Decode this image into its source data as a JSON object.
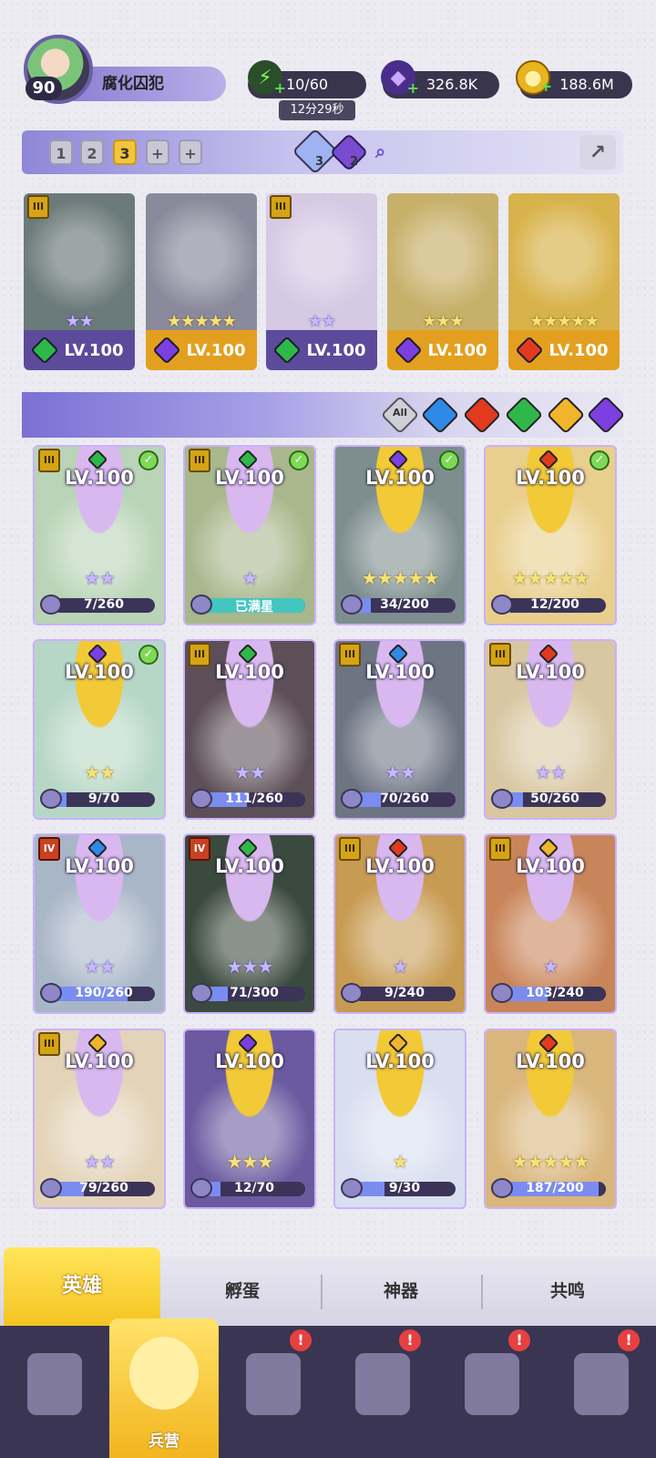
{
  "player": {
    "level": "90",
    "name": "腐化囚犯"
  },
  "resources": {
    "energy": "10/60",
    "energy_timer": "12分29秒",
    "gems": "326.8K",
    "gold": "188.6M"
  },
  "team_tabs": [
    "1",
    "2",
    "3",
    "+",
    "+"
  ],
  "team_tab_active": "3",
  "crystals": [
    {
      "name": "blue-crystal",
      "count": "3",
      "color": "#9fb3f2"
    },
    {
      "name": "purple-crystal",
      "count": "2",
      "color": "#7a4bd0"
    }
  ],
  "element_colors": {
    "green": "#2fb84a",
    "dark": "#7c3fe0",
    "fire": "#e23a1e",
    "water": "#2f89e6",
    "light": "#f0b52c"
  },
  "team": [
    {
      "level": "LV.100",
      "element": "green",
      "rank": "III",
      "stars": "★★",
      "star_style": "purple",
      "bg": "#6b7a7a",
      "foot": "#5c4b9a"
    },
    {
      "level": "LV.100",
      "element": "dark",
      "rank": "",
      "stars": "★★★★★",
      "star_style": "gold",
      "bg": "#8a8a9c",
      "foot": "#e3a020"
    },
    {
      "level": "LV.100",
      "element": "green",
      "rank": "III",
      "stars": "★★",
      "star_style": "purple",
      "bg": "#d6c9e4",
      "foot": "#5c4b9a"
    },
    {
      "level": "LV.100",
      "element": "dark",
      "rank": "",
      "stars": "★★★",
      "star_style": "gold",
      "bg": "#c7b06a",
      "foot": "#e3a020"
    },
    {
      "level": "LV.100",
      "element": "fire",
      "rank": "",
      "stars": "★★★★★",
      "star_style": "gold",
      "bg": "#d8b24a",
      "foot": "#e3a020"
    }
  ],
  "filter": {
    "all_label": "All",
    "elements": [
      "water",
      "fire",
      "green",
      "light",
      "dark"
    ]
  },
  "heroes": [
    {
      "level": "LV.100",
      "element": "green",
      "rank": "III",
      "check": true,
      "stars": "★★",
      "star_style": "purple",
      "progress": "7/260",
      "fill": 0.03,
      "bg": "#b9d4b6"
    },
    {
      "level": "LV.100",
      "element": "green",
      "rank": "III",
      "check": true,
      "stars": "★",
      "star_style": "purple",
      "progress": "已满星",
      "fill": 1,
      "bg": "#a9b78d"
    },
    {
      "level": "LV.100",
      "element": "dark",
      "rank": "",
      "check": true,
      "stars": "★★★★★",
      "star_style": "gold",
      "progress": "34/200",
      "fill": 0.17,
      "bg": "#7e8e8f"
    },
    {
      "level": "LV.100",
      "element": "fire",
      "rank": "",
      "check": true,
      "stars": "★★★★★",
      "star_style": "gold",
      "progress": "12/200",
      "fill": 0.06,
      "bg": "#e9cf8d"
    },
    {
      "level": "LV.100",
      "element": "dark",
      "rank": "",
      "check": true,
      "stars": "★★",
      "star_style": "gold",
      "progress": "9/70",
      "fill": 0.13,
      "bg": "#b7d7c6"
    },
    {
      "level": "LV.100",
      "element": "green",
      "rank": "III",
      "check": false,
      "stars": "★★",
      "star_style": "purple",
      "progress": "111/260",
      "fill": 0.43,
      "bg": "#5d4f57"
    },
    {
      "level": "LV.100",
      "element": "water",
      "rank": "III",
      "check": false,
      "stars": "★★",
      "star_style": "purple",
      "progress": "70/260",
      "fill": 0.27,
      "bg": "#6d7583"
    },
    {
      "level": "LV.100",
      "element": "fire",
      "rank": "III",
      "check": false,
      "stars": "★★",
      "star_style": "purple",
      "progress": "50/260",
      "fill": 0.19,
      "bg": "#d8c7a2"
    },
    {
      "level": "LV.100",
      "element": "water",
      "rank": "IV",
      "check": false,
      "stars": "★★",
      "star_style": "purple",
      "progress": "190/260",
      "fill": 0.73,
      "bg": "#a9b6c8"
    },
    {
      "level": "LV.100",
      "element": "green",
      "rank": "IV",
      "check": false,
      "stars": "★★★",
      "star_style": "purple",
      "progress": "71/300",
      "fill": 0.24,
      "bg": "#3b4a3e"
    },
    {
      "level": "LV.100",
      "element": "fire",
      "rank": "III",
      "check": false,
      "stars": "★",
      "star_style": "purple",
      "progress": "9/240",
      "fill": 0.04,
      "bg": "#c79b52"
    },
    {
      "level": "LV.100",
      "element": "light",
      "rank": "III",
      "check": false,
      "stars": "★",
      "star_style": "purple",
      "progress": "103/240",
      "fill": 0.43,
      "bg": "#c9855a"
    },
    {
      "level": "LV.100",
      "element": "light",
      "rank": "III",
      "check": false,
      "stars": "★★",
      "star_style": "purple",
      "progress": "79/260",
      "fill": 0.3,
      "bg": "#e3d3b8"
    },
    {
      "level": "LV.100",
      "element": "dark",
      "rank": "",
      "check": false,
      "stars": "★★★",
      "star_style": "gold",
      "progress": "12/70",
      "fill": 0.17,
      "bg": "#6b5aa0"
    },
    {
      "level": "LV.100",
      "element": "light",
      "rank": "",
      "check": false,
      "stars": "★",
      "star_style": "gold",
      "progress": "9/30",
      "fill": 0.3,
      "bg": "#d9dff0"
    },
    {
      "level": "LV.100",
      "element": "fire",
      "rank": "",
      "check": false,
      "stars": "★★★★★",
      "star_style": "gold",
      "progress": "187/200",
      "fill": 0.93,
      "bg": "#d9b67c"
    }
  ],
  "sub_tabs": [
    "英雄",
    "孵蛋",
    "神器",
    "共鸣"
  ],
  "sub_tab_active": "英雄",
  "bottom_nav": [
    {
      "name": "cards",
      "label": "",
      "alert": false
    },
    {
      "name": "barracks",
      "label": "兵营",
      "alert": false
    },
    {
      "name": "map",
      "label": "",
      "alert": true
    },
    {
      "name": "castle",
      "label": "",
      "alert": true
    },
    {
      "name": "mushroom",
      "label": "",
      "alert": true
    },
    {
      "name": "guild",
      "label": "",
      "alert": true
    }
  ]
}
